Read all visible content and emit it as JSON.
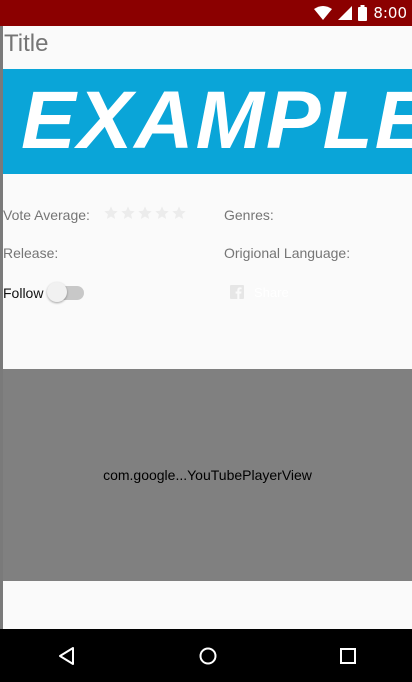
{
  "status_bar": {
    "time": "8:00",
    "icons": [
      "wifi-icon",
      "cell-signal-icon",
      "battery-icon"
    ],
    "background": "#8b0000"
  },
  "app": {
    "title": "Title",
    "banner_text": "EXAMPLE",
    "banner_color": "#0aa5d8"
  },
  "details": {
    "vote_average_label": "Vote Average:",
    "rating": {
      "value": 0,
      "max": 5
    },
    "genres_label": "Genres:",
    "release_label": "Release:",
    "original_language_label": "Origional Language:"
  },
  "actions": {
    "follow_label": "Follow",
    "follow_on": false,
    "share_label": "Share",
    "share_icon": "facebook-icon"
  },
  "player": {
    "label": "com.google...YouTubePlayerView"
  },
  "nav": {
    "icons": [
      "back-icon",
      "home-icon",
      "recents-icon"
    ]
  }
}
